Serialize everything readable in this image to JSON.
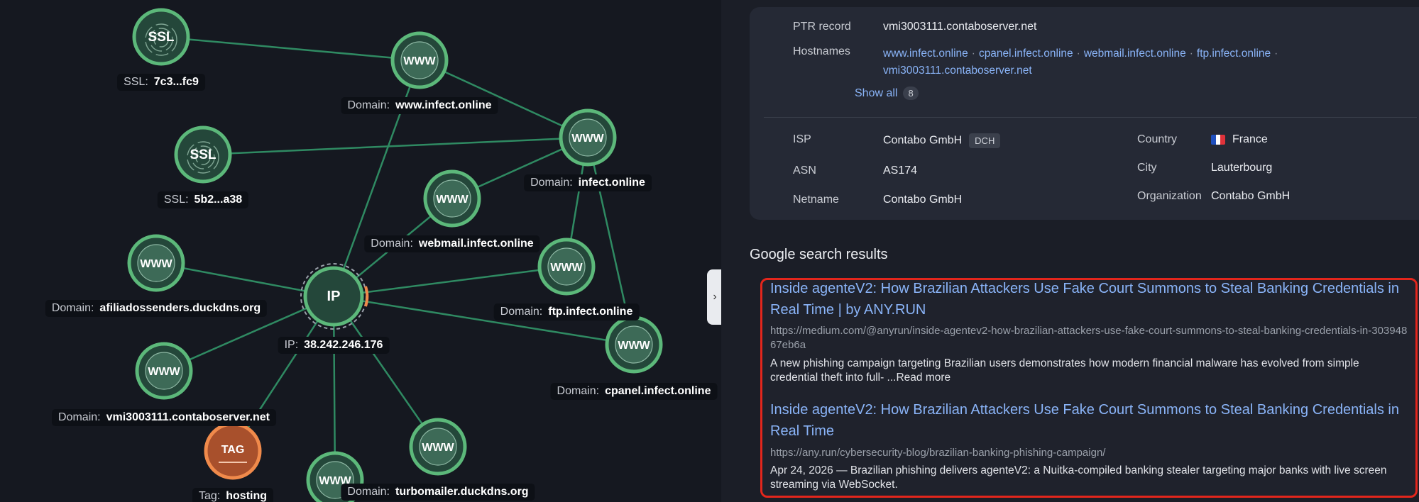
{
  "graph": {
    "nodes": [
      {
        "id": "ssl1",
        "icon": "SSL",
        "kind": "ssl",
        "label_key": "SSL:",
        "label_val": "7c3...fc9"
      },
      {
        "id": "ssl2",
        "icon": "SSL",
        "kind": "ssl",
        "label_key": "SSL:",
        "label_val": "5b2...a38"
      },
      {
        "id": "www_infect",
        "icon": "WWW",
        "kind": "www",
        "label_key": "Domain:",
        "label_val": "www.infect.online"
      },
      {
        "id": "infect",
        "icon": "WWW",
        "kind": "www",
        "label_key": "Domain:",
        "label_val": "infect.online"
      },
      {
        "id": "webmail",
        "icon": "WWW",
        "kind": "www",
        "label_key": "Domain:",
        "label_val": "webmail.infect.online"
      },
      {
        "id": "ftp",
        "icon": "WWW",
        "kind": "www",
        "label_key": "Domain:",
        "label_val": "ftp.infect.online"
      },
      {
        "id": "cpanel",
        "icon": "WWW",
        "kind": "www",
        "label_key": "Domain:",
        "label_val": "cpanel.infect.online"
      },
      {
        "id": "afilia",
        "icon": "WWW",
        "kind": "www",
        "label_key": "Domain:",
        "label_val": "afiliadossenders.duckdns.org"
      },
      {
        "id": "ip",
        "icon": "IP",
        "kind": "ip",
        "label_key": "IP:",
        "label_val": "38.242.246.176"
      },
      {
        "id": "vmi",
        "icon": "WWW",
        "kind": "www",
        "label_key": "Domain:",
        "label_val": "vmi3003111.contaboserver.net"
      },
      {
        "id": "tag",
        "icon": "TAG",
        "kind": "tag",
        "label_key": "Tag:",
        "label_val": "hosting"
      },
      {
        "id": "turbo",
        "icon": "WWW",
        "kind": "www",
        "label_key": "Domain:",
        "label_val": "turbomailer.duckdns.org"
      },
      {
        "id": "bottom",
        "icon": "WWW",
        "kind": "www",
        "label_key": "",
        "label_val": ""
      }
    ]
  },
  "info": {
    "ptr_label": "PTR record",
    "ptr_value": "vmi3003111.contaboserver.net",
    "hostnames_label": "Hostnames",
    "hostnames": [
      "www.infect.online",
      "cpanel.infect.online",
      "webmail.infect.online",
      "ftp.infect.online"
    ],
    "hostname_last": "vmi3003111.contaboserver.net",
    "separator": "·",
    "show_all_label": "Show all",
    "show_all_count": "8",
    "isp_label": "ISP",
    "isp_value": "Contabo GmbH",
    "isp_badge": "DCH",
    "asn_label": "ASN",
    "asn_value": "AS174",
    "netname_label": "Netname",
    "netname_value": "Contabo GmbH",
    "country_label": "Country",
    "country_value": "France",
    "city_label": "City",
    "city_value": "Lauterbourg",
    "org_label": "Organization",
    "org_value": "Contabo GmbH",
    "flag_colors": [
      "#1f4fbf",
      "#ffffff",
      "#e0323a"
    ]
  },
  "google": {
    "title": "Google search results",
    "results": [
      {
        "title_l1": "Inside agenteV2: How Brazilian Attackers Use Fake Court Summons to Steal Banking Credentials in",
        "title_l2": "Real Time | by ANY.RUN",
        "url": "https://medium.com/@anyrun/inside-agentev2-how-brazilian-attackers-use-fake-court-summons-to-steal-banking-credentials-in-30394867eb6a",
        "snippet": "A new phishing campaign targeting Brazilian users demonstrates how modern financial malware has evolved from simple credential theft into full- ...Read more"
      },
      {
        "title_l1": "Inside agenteV2: How Brazilian Attackers Use Fake Court Summons to Steal Banking Credentials in",
        "title_l2": "Real Time",
        "url": "https://any.run/cybersecurity-blog/brazilian-banking-phishing-campaign/",
        "snippet": "Apr 24, 2026 — Brazilian phishing delivers agenteV2: a Nuitka-compiled banking stealer targeting major banks with live screen streaming via WebSocket."
      }
    ]
  },
  "colors": {
    "node_green": "#5cb87a",
    "node_fill": "#24473a",
    "edge": "#2f8a62",
    "tag_orange": "#f08a4b",
    "highlight": "#e3261c"
  }
}
